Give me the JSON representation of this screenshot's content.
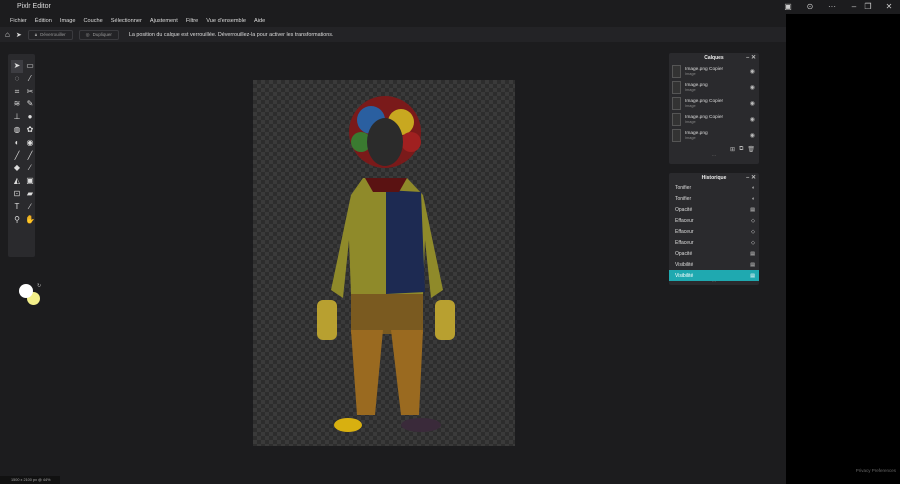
{
  "app": {
    "title": "Pixlr Editor"
  },
  "menu": [
    "Fichier",
    "Édition",
    "Image",
    "Couche",
    "Sélectionner",
    "Ajustement",
    "Filtre",
    "Vue d'ensemble",
    "Aide"
  ],
  "toolbar": {
    "unlock_label": "Déverrouiller",
    "duplicate_label": "Dupliquer",
    "message": "La position du calque est verrouillée. Déverrouillez-la pour activer les transformations."
  },
  "layers": {
    "title": "Calques",
    "items": [
      {
        "name": "Image.png Copier",
        "type": "Image"
      },
      {
        "name": "Image.png",
        "type": "Image"
      },
      {
        "name": "Image.png Copier",
        "type": "Image"
      },
      {
        "name": "Image.png Copier",
        "type": "Image"
      },
      {
        "name": "Image.png",
        "type": "Image"
      }
    ]
  },
  "history": {
    "title": "Historique",
    "items": [
      "Tonifier",
      "Tonifier",
      "Opacité",
      "Effaceur",
      "Effaceur",
      "Effaceur",
      "Opacité",
      "Visibilité",
      "Visibilité"
    ],
    "active_index": 8
  },
  "colors": {
    "foreground": "#ffffff",
    "background": "#f3ef8a",
    "accent": "#1fa9b0"
  },
  "status": "1500 x 2100 px @ 44%",
  "footer": {
    "privacy": "Privacy Preferences"
  }
}
